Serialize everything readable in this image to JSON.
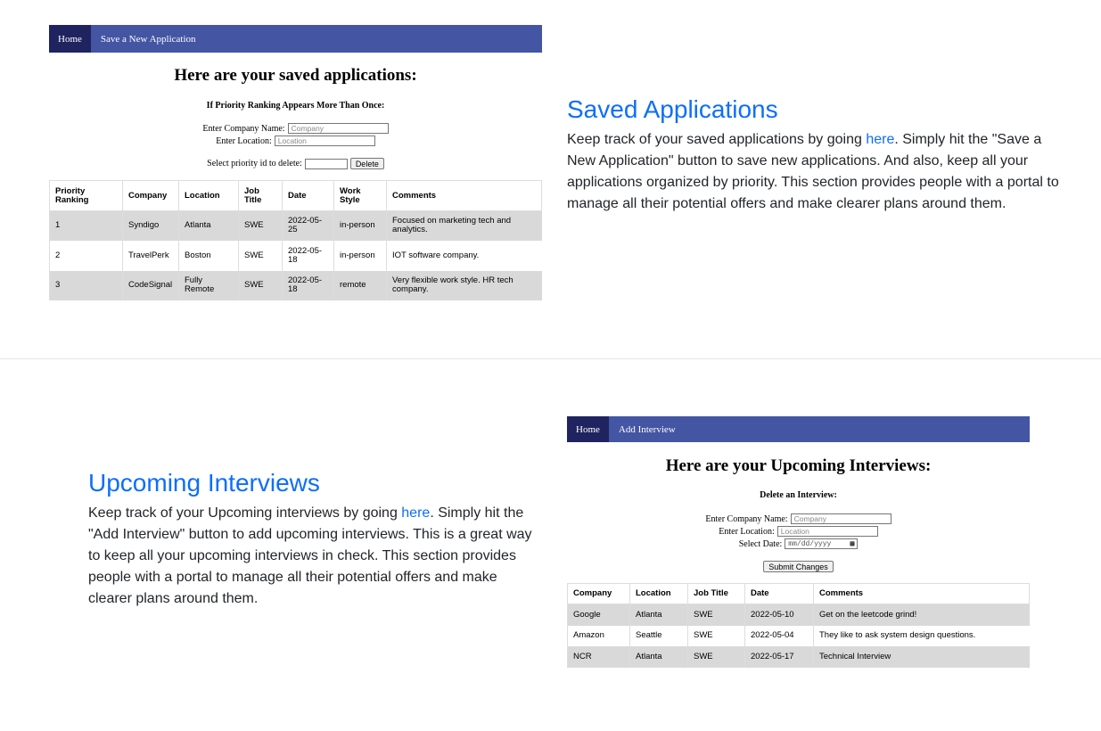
{
  "saved_app": {
    "nav": {
      "home": "Home",
      "link": "Save a New Application"
    },
    "title": "Here are your saved applications:",
    "subtitle": "If Priority Ranking Appears More Than Once:",
    "company_label": "Enter Company Name:",
    "company_placeholder": "Company",
    "location_label": "Enter Location:",
    "location_placeholder": "Location",
    "priority_label": "Select priority id to delete:",
    "priority_value": "",
    "delete_button": "Delete",
    "table": {
      "headers": [
        "Priority Ranking",
        "Company",
        "Location",
        "Job Title",
        "Date",
        "Work Style",
        "Comments"
      ],
      "rows": [
        [
          "1",
          "Syndigo",
          "Atlanta",
          "SWE",
          "2022-05-25",
          "in-person",
          "Focused on marketing tech and analytics."
        ],
        [
          "2",
          "TravelPerk",
          "Boston",
          "SWE",
          "2022-05-18",
          "in-person",
          "IOT software company."
        ],
        [
          "3",
          "CodeSignal",
          "Fully Remote",
          "SWE",
          "2022-05-18",
          "remote",
          "Very flexible work style. HR tech company."
        ]
      ]
    }
  },
  "saved_section": {
    "heading": "Saved Applications",
    "body_before": "Keep track of your saved applications by going ",
    "link": "here",
    "body_after": ". Simply hit the \"Save a New Application\" button to save new applications. And also, keep all your applications organized by priority. This section provides people with a portal to manage all their potential offers and make clearer plans around them."
  },
  "interviews_section": {
    "heading": "Upcoming Interviews",
    "body_before": "Keep track of your Upcoming interviews by going ",
    "link": "here",
    "body_after": ". Simply hit the \"Add Interview\" button to add upcoming interviews. This is a great way to keep all your upcoming interviews in check. This section provides people with a portal to manage all their potential offers and make clearer plans around them."
  },
  "interview_app": {
    "nav": {
      "home": "Home",
      "link": "Add Interview"
    },
    "title": "Here are your Upcoming Interviews:",
    "subtitle": "Delete an Interview:",
    "company_label": "Enter Company Name:",
    "company_placeholder": "Company",
    "location_label": "Enter Location:",
    "location_placeholder": "Location",
    "date_label": "Select Date:",
    "date_placeholder": "mm/dd/yyyy",
    "submit_button": "Submit Changes",
    "table": {
      "headers": [
        "Company",
        "Location",
        "Job Title",
        "Date",
        "Comments"
      ],
      "rows": [
        [
          "Google",
          "Atlanta",
          "SWE",
          "2022-05-10",
          "Get on the leetcode grind!"
        ],
        [
          "Amazon",
          "Seattle",
          "SWE",
          "2022-05-04",
          "They like to ask system design questions."
        ],
        [
          "NCR",
          "Atlanta",
          "SWE",
          "2022-05-17",
          "Technical Interview"
        ]
      ]
    }
  },
  "colors": {
    "accent": "#0d6efd",
    "navbar": "#4355a3",
    "navbar_active": "#1f2460",
    "row_shade": "#d9d9d9"
  }
}
